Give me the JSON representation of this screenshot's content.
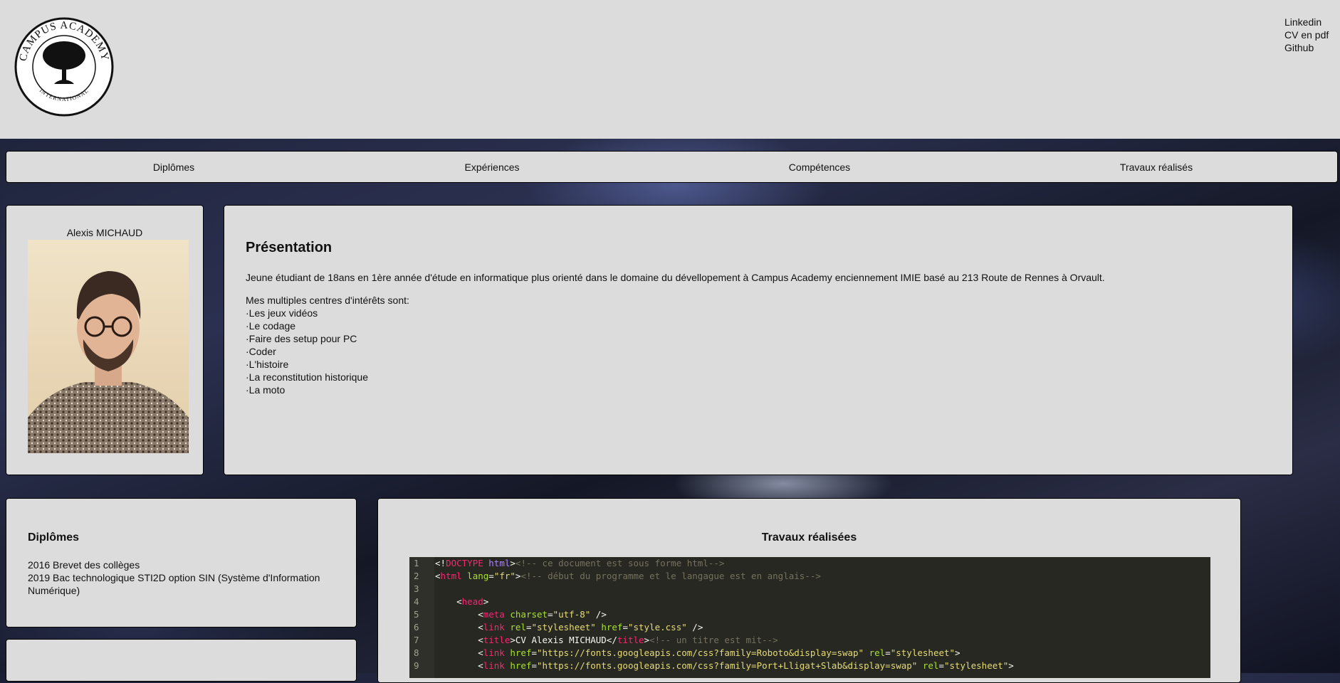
{
  "header": {
    "logo": {
      "name": "campus-academy-logo",
      "text_top": "CAMPUS ACADEMY",
      "text_bottom": "INTERNATIONAL"
    },
    "links": [
      "Linkedin",
      "CV en pdf",
      "Github"
    ]
  },
  "nav": {
    "items": [
      "Diplômes",
      "Expériences",
      "Compétences",
      "Travaux réalisés"
    ]
  },
  "profile": {
    "name": "Alexis MICHAUD"
  },
  "presentation": {
    "title": "Présentation",
    "intro": "Jeune étudiant de 18ans en 1ère année d'étude en informatique plus orienté dans le domaine du dévellopement à Campus Academy enciennement IMIE basé au 213 Route de Rennes à Orvault.",
    "interests_heading": "Mes multiples centres d'intérêts sont:",
    "interests": [
      "·Les jeux vidéos",
      "·Le codage",
      "·Faire des setup pour PC",
      "·Coder",
      "·L'histoire",
      "·La reconstitution historique",
      "·La moto"
    ]
  },
  "diplomes": {
    "title": "Diplômes",
    "items": [
      "2016 Brevet des collèges",
      "2019 Bac technologique STI2D option SIN (Système d'Information Numérique)"
    ]
  },
  "travaux": {
    "title": "Travaux réalisées",
    "line_numbers": [
      "1",
      "2",
      "3",
      "4",
      "5",
      "6",
      "7",
      "8",
      "9"
    ]
  },
  "colors": {
    "panel_bg": "#dcdcdc",
    "code_bg": "#272822"
  }
}
